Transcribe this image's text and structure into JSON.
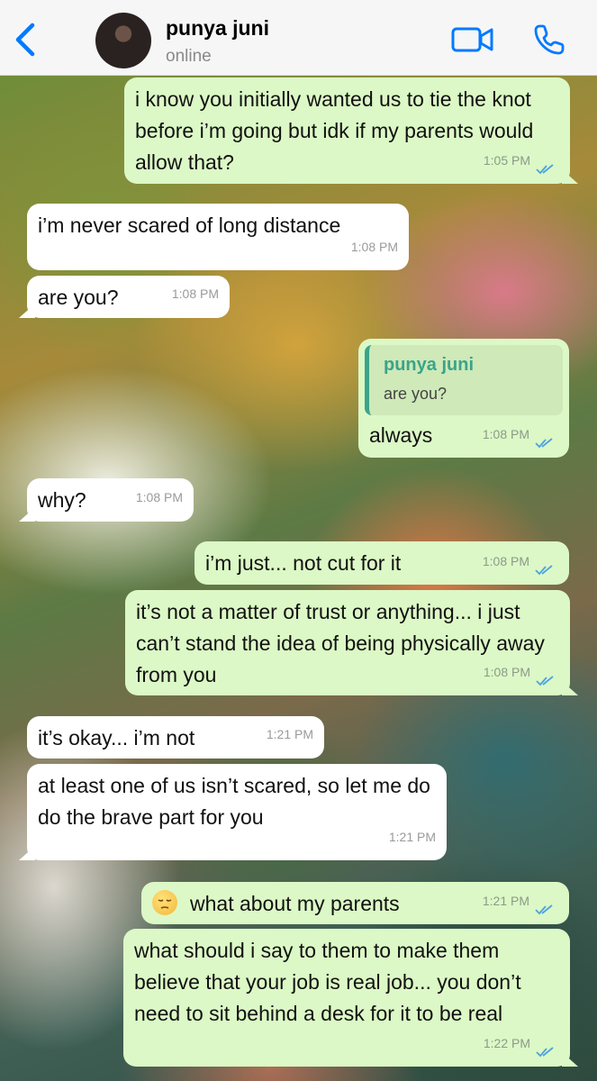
{
  "header": {
    "contact_name": "punya juni",
    "status": "online"
  },
  "colors": {
    "accent": "#007aff",
    "outgoing_bubble": "#dcf8c6",
    "incoming_bubble": "#ffffff",
    "read_ticks": "#4fa3e0",
    "quote_bar": "#3aa48a"
  },
  "icons": {
    "back": "chevron-left-icon",
    "video": "video-camera-icon",
    "call": "phone-icon",
    "read_receipt": "double-check-icon",
    "emoji": "pensive-face-emoji"
  },
  "messages": [
    {
      "direction": "out",
      "text": "i know you initially wanted us to tie the knot before i’m going but idk if my parents would allow that?",
      "time": "1:05 PM"
    },
    {
      "direction": "in",
      "text": "i’m never scared of long distance",
      "time": "1:08 PM"
    },
    {
      "direction": "in",
      "text": "are you?",
      "time": "1:08 PM"
    },
    {
      "direction": "out",
      "quote_author": "punya juni",
      "quote_text": "are you?",
      "text": "always",
      "time": "1:08 PM"
    },
    {
      "direction": "in",
      "text": "why?",
      "time": "1:08 PM"
    },
    {
      "direction": "out",
      "text": "i’m just... not cut for it",
      "time": "1:08 PM"
    },
    {
      "direction": "out",
      "text": "it’s not a matter of trust or anything... i just can’t stand the idea of being physically away from you",
      "time": "1:08 PM"
    },
    {
      "direction": "in",
      "text": "it’s okay... i’m not",
      "time": "1:21 PM"
    },
    {
      "direction": "in",
      "text": "at least one of us isn’t scared, so let me do do the brave part for you",
      "time": "1:21 PM"
    },
    {
      "direction": "out",
      "text": "what about my parents",
      "time": "1:21 PM"
    },
    {
      "direction": "out",
      "text": "what should i say to them to make them believe that your job is real job... you don’t need to sit behind a desk for it to be real",
      "time": "1:22 PM"
    }
  ]
}
